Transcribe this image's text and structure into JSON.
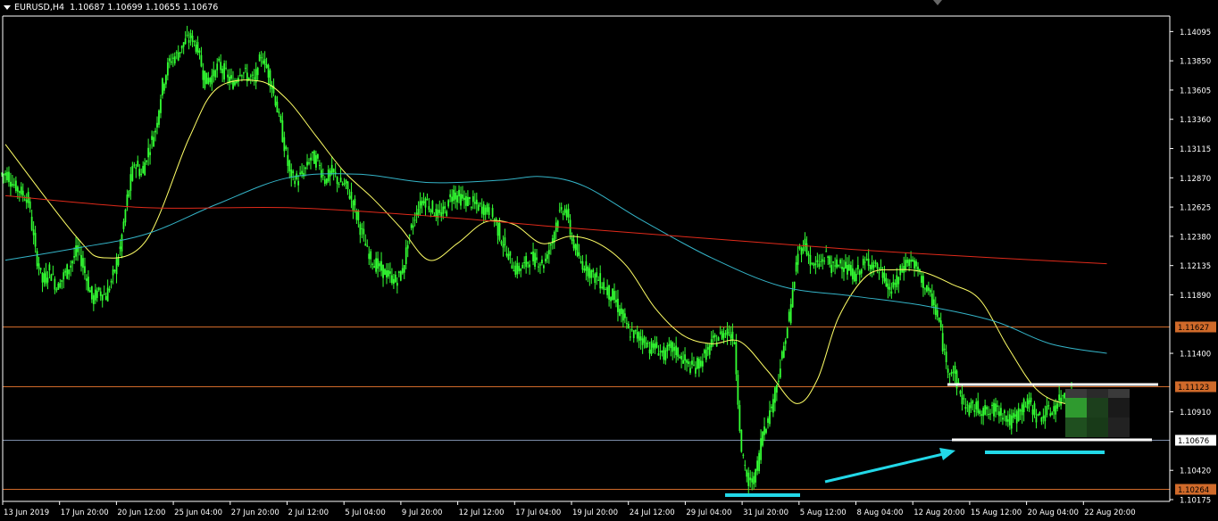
{
  "window": {
    "symbol": "EURUSD,H4",
    "ohlc": "1.10687 1.10699 1.10655 1.10676"
  },
  "colors": {
    "background": "#000000",
    "candle": "#33ff33",
    "axis": "#ffffff",
    "ma_fast": "#ffff66",
    "ma_mid": "#34b4c8",
    "ma_slow": "#e02a1a",
    "level_line": "#d06a2a",
    "level_label_bg": "#d06a2a",
    "current_line": "#7c8ca8",
    "current_label_bg": "#ffffff",
    "annotation_white": "#ffffff",
    "annotation_cyan": "#22d8e8"
  },
  "chart_data": {
    "type": "candlestick",
    "ylim": [
      1.10175,
      1.1415
    ],
    "y_ticks": [
      "1.14095",
      "1.13850",
      "1.13605",
      "1.13360",
      "1.13115",
      "1.12870",
      "1.12625",
      "1.12380",
      "1.12135",
      "1.11890",
      "1.11400",
      "1.10910",
      "1.10420",
      "1.10175"
    ],
    "x_ticks": [
      "13 Jun 2019",
      "17 Jun 20:00",
      "20 Jun 12:00",
      "25 Jun 04:00",
      "27 Jun 20:00",
      "2 Jul 12:00",
      "5 Jul 04:00",
      "9 Jul 20:00",
      "12 Jul 12:00",
      "17 Jul 04:00",
      "19 Jul 20:00",
      "24 Jul 12:00",
      "29 Jul 04:00",
      "31 Jul 20:00",
      "5 Aug 12:00",
      "8 Aug 04:00",
      "12 Aug 20:00",
      "15 Aug 12:00",
      "20 Aug 04:00",
      "22 Aug 20:00"
    ],
    "price_series": [
      1.129,
      1.128,
      1.1275,
      1.1268,
      1.1225,
      1.12,
      1.121,
      1.1195,
      1.1205,
      1.1215,
      1.1228,
      1.1208,
      1.1185,
      1.1192,
      1.1188,
      1.1205,
      1.1228,
      1.127,
      1.13,
      1.129,
      1.131,
      1.1328,
      1.1365,
      1.1385,
      1.139,
      1.14,
      1.1405,
      1.1395,
      1.1368,
      1.1372,
      1.1382,
      1.1373,
      1.1365,
      1.1378,
      1.1372,
      1.1368,
      1.139,
      1.1375,
      1.1352,
      1.1322,
      1.129,
      1.1285,
      1.1292,
      1.1305,
      1.13,
      1.1285,
      1.1292,
      1.1283,
      1.128,
      1.1265,
      1.1245,
      1.1225,
      1.1215,
      1.121,
      1.1205,
      1.12,
      1.121,
      1.124,
      1.126,
      1.127,
      1.1262,
      1.1255,
      1.126,
      1.1275,
      1.127,
      1.1268,
      1.1265,
      1.1262,
      1.126,
      1.1252,
      1.1235,
      1.122,
      1.121,
      1.1212,
      1.122,
      1.1218,
      1.1215,
      1.1232,
      1.1255,
      1.1262,
      1.1235,
      1.1218,
      1.1212,
      1.1205,
      1.12,
      1.1192,
      1.1185,
      1.1172,
      1.1158,
      1.1155,
      1.1152,
      1.1145,
      1.1145,
      1.1138,
      1.1145,
      1.114,
      1.1132,
      1.1128,
      1.1132,
      1.114,
      1.115,
      1.1155,
      1.116,
      1.115,
      1.1055,
      1.103,
      1.1038,
      1.1075,
      1.109,
      1.1115,
      1.1145,
      1.118,
      1.1225,
      1.1232,
      1.1212,
      1.1215,
      1.1222,
      1.121,
      1.1218,
      1.121,
      1.1205,
      1.1212,
      1.1218,
      1.1212,
      1.1205,
      1.1192,
      1.12,
      1.1215,
      1.1218,
      1.1208,
      1.1195,
      1.1185,
      1.1165,
      1.113,
      1.1125,
      1.1105,
      1.1093,
      1.1095,
      1.1093,
      1.1089,
      1.1095,
      1.109,
      1.1082,
      1.1088,
      1.1097,
      1.1097,
      1.1085,
      1.109,
      1.1092,
      1.11,
      1.1108,
      1.1103
    ],
    "moving_averages": [
      {
        "color": "#ffff66",
        "points": [
          [
            0,
            1.1315
          ],
          [
            10,
            1.1238
          ],
          [
            14,
            1.122
          ],
          [
            20,
            1.1235
          ],
          [
            26,
            1.132
          ],
          [
            30,
            1.1362
          ],
          [
            36,
            1.1368
          ],
          [
            40,
            1.1352
          ],
          [
            44,
            1.1322
          ],
          [
            48,
            1.1292
          ],
          [
            52,
            1.127
          ],
          [
            56,
            1.1245
          ],
          [
            60,
            1.1218
          ],
          [
            64,
            1.1232
          ],
          [
            68,
            1.125
          ],
          [
            72,
            1.1248
          ],
          [
            76,
            1.1232
          ],
          [
            80,
            1.1238
          ],
          [
            84,
            1.1232
          ],
          [
            88,
            1.1213
          ],
          [
            92,
            1.1178
          ],
          [
            96,
            1.1155
          ],
          [
            100,
            1.1148
          ],
          [
            104,
            1.115
          ],
          [
            108,
            1.1125
          ],
          [
            112,
            1.1098
          ],
          [
            115,
            1.1118
          ],
          [
            118,
            1.117
          ],
          [
            122,
            1.1205
          ],
          [
            126,
            1.121
          ],
          [
            130,
            1.1208
          ],
          [
            134,
            1.1198
          ],
          [
            138,
            1.1185
          ],
          [
            142,
            1.1145
          ],
          [
            146,
            1.111
          ],
          [
            150,
            1.1098
          ],
          [
            154,
            1.11
          ],
          [
            158,
            1.1103
          ]
        ]
      },
      {
        "color": "#34b4c8",
        "points": [
          [
            0,
            1.1218
          ],
          [
            10,
            1.1228
          ],
          [
            20,
            1.124
          ],
          [
            30,
            1.1265
          ],
          [
            40,
            1.1287
          ],
          [
            50,
            1.129
          ],
          [
            60,
            1.1283
          ],
          [
            70,
            1.1285
          ],
          [
            76,
            1.1288
          ],
          [
            82,
            1.128
          ],
          [
            90,
            1.1252
          ],
          [
            100,
            1.122
          ],
          [
            110,
            1.1196
          ],
          [
            120,
            1.1188
          ],
          [
            130,
            1.118
          ],
          [
            140,
            1.1167
          ],
          [
            148,
            1.1148
          ],
          [
            156,
            1.114
          ]
        ]
      },
      {
        "color": "#e02a1a",
        "points": [
          [
            0,
            1.1272
          ],
          [
            20,
            1.1262
          ],
          [
            40,
            1.1262
          ],
          [
            60,
            1.1255
          ],
          [
            80,
            1.1245
          ],
          [
            100,
            1.1236
          ],
          [
            120,
            1.1227
          ],
          [
            140,
            1.122
          ],
          [
            156,
            1.1215
          ]
        ]
      }
    ],
    "horizontal_levels": [
      {
        "price": 1.11627,
        "label": "1.11627",
        "kind": "level"
      },
      {
        "price": 1.11123,
        "label": "1.11123",
        "kind": "level"
      },
      {
        "price": 1.10676,
        "label": "1.10676",
        "kind": "current"
      },
      {
        "price": 1.10264,
        "label": "1.10264",
        "kind": "level"
      }
    ],
    "grid": false,
    "legend": "none"
  }
}
